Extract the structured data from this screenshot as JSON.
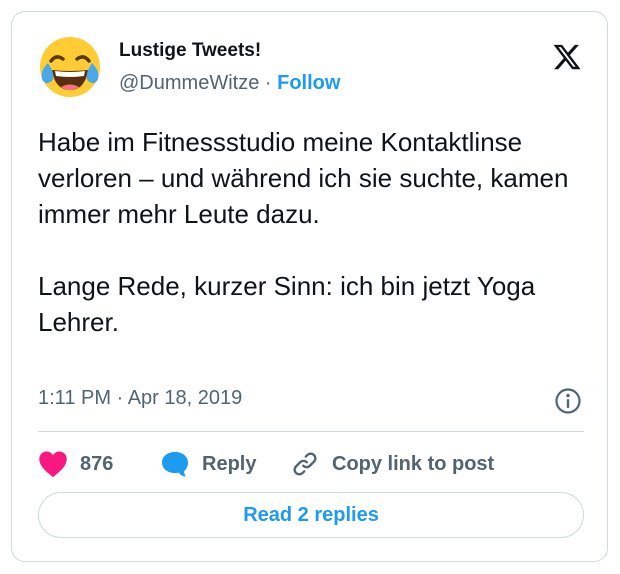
{
  "author": {
    "name": "Lustige Tweets!",
    "handle": "@DummeWitze",
    "separator": "·",
    "follow_label": "Follow",
    "avatar_icon": "face-with-tears-of-joy-emoji"
  },
  "tweet": {
    "paragraphs": [
      "Habe im Fitnessstudio meine Kontaktlinse verloren – und während ich sie suchte, kamen immer mehr Leute dazu.",
      "Lange Rede, kurzer Sinn: ich bin jetzt Yoga Lehrer."
    ],
    "time": "1:11 PM",
    "separator": "·",
    "date": "Apr 18, 2019"
  },
  "actions": {
    "like_count": "876",
    "reply_label": "Reply",
    "copy_label": "Copy link to post",
    "read_replies_label": "Read 2 replies"
  },
  "icons": {
    "brand": "x-logo-icon",
    "info": "info-icon",
    "like": "heart-icon",
    "reply": "speech-bubble-icon",
    "copy": "link-icon"
  },
  "colors": {
    "accent": "#1d9bf0",
    "like": "#f91880",
    "text": "#0f1419",
    "secondary": "#536471",
    "border": "#cfd9de"
  }
}
